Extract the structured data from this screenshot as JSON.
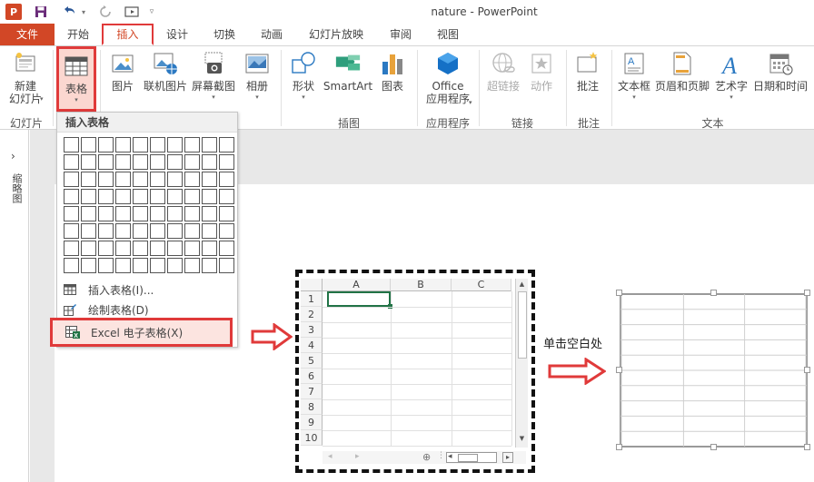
{
  "titlebar": {
    "logo": "P",
    "title": "nature - PowerPoint",
    "icons": [
      "save-icon",
      "undo-icon",
      "redo-icon",
      "start-from-beginning-icon",
      "customize-quick-access-icon"
    ]
  },
  "tabs": [
    {
      "label": "文件",
      "active": false
    },
    {
      "label": "开始",
      "active": false
    },
    {
      "label": "插入",
      "active": true
    },
    {
      "label": "设计",
      "active": false
    },
    {
      "label": "切换",
      "active": false
    },
    {
      "label": "动画",
      "active": false
    },
    {
      "label": "幻灯片放映",
      "active": false
    },
    {
      "label": "审阅",
      "active": false
    },
    {
      "label": "视图",
      "active": false
    }
  ],
  "ribbon": {
    "new_slide": {
      "label1": "新建",
      "label2": "幻灯片",
      "dropdown": "▾"
    },
    "table": {
      "label": "表格",
      "dropdown": "▾"
    },
    "picture": {
      "label": "图片"
    },
    "online_picture": {
      "label": "联机图片"
    },
    "screenshot": {
      "label": "屏幕截图",
      "dropdown": "▾"
    },
    "album": {
      "label": "相册",
      "dropdown": "▾"
    },
    "shapes": {
      "label": "形状",
      "dropdown": "▾"
    },
    "smartart": {
      "label": "SmartArt"
    },
    "chart": {
      "label": "图表"
    },
    "office_apps": {
      "label1": "Office",
      "label2": "应用程序",
      "dropdown": "▾"
    },
    "hyperlink": {
      "label": "超链接"
    },
    "action": {
      "label": "动作"
    },
    "comment": {
      "label": "批注"
    },
    "textbox": {
      "label": "文本框",
      "dropdown": "▾"
    },
    "header_footer": {
      "label": "页眉和页脚"
    },
    "wordart": {
      "label": "艺术字",
      "dropdown": "▾"
    },
    "datetime": {
      "label": "日期和时间"
    },
    "groups": {
      "slides": "幻灯片",
      "illustrations": "插图",
      "apps": "应用程序",
      "links": "链接",
      "comments": "批注",
      "text": "文本"
    }
  },
  "dropdown": {
    "header": "插入表格",
    "grid_cols": 10,
    "grid_rows": 8,
    "items": [
      {
        "label": "插入表格(I)..."
      },
      {
        "label": "绘制表格(D)"
      },
      {
        "label": "Excel 电子表格(X)"
      }
    ]
  },
  "left_pane": {
    "arrow": "›",
    "label": "缩略图"
  },
  "excel": {
    "columns": [
      "A",
      "B",
      "C"
    ],
    "rows": [
      "1",
      "2",
      "3",
      "4",
      "5",
      "6",
      "7",
      "8",
      "9",
      "10"
    ]
  },
  "annotation": {
    "click_blank": "单击空白处"
  },
  "colors": {
    "accent": "#d24726",
    "highlight_border": "#e03a3a",
    "excel_green": "#217346"
  }
}
